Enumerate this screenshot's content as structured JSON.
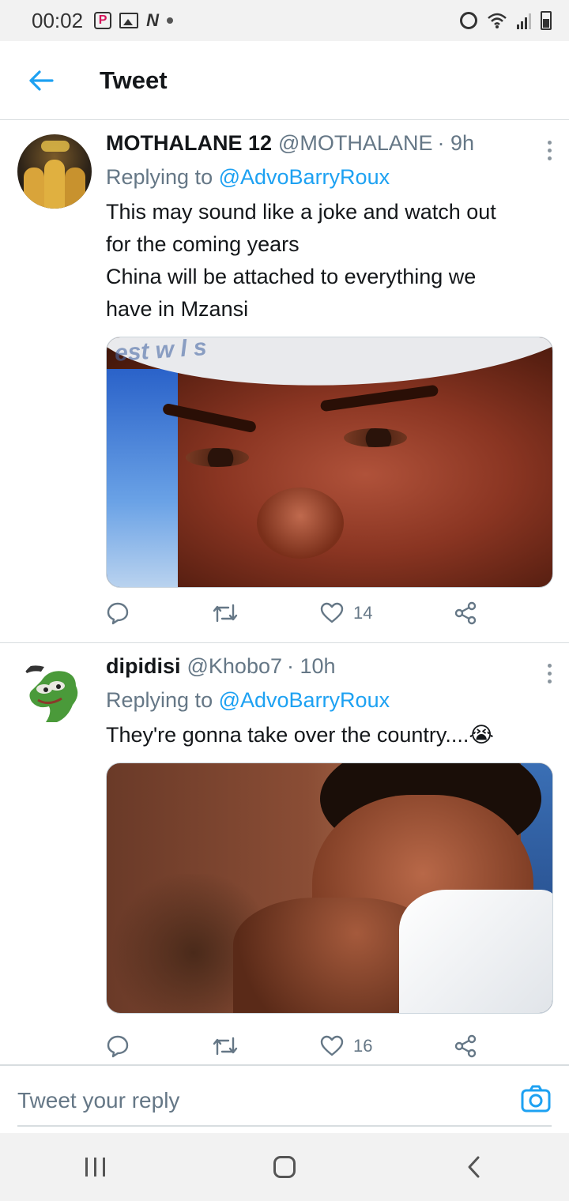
{
  "status_bar": {
    "time": "00:02",
    "icons": [
      "p-app-icon",
      "gallery-icon",
      "n-app-icon",
      "dot-icon",
      "alarm-icon",
      "wifi-icon",
      "signal-icon",
      "battery-icon"
    ]
  },
  "app_bar": {
    "title": "Tweet",
    "back_icon": "arrow-left-icon",
    "accent_color": "#1da1f2"
  },
  "tweets": [
    {
      "display_name": "MOTHALANE 12",
      "handle": "@MOTHALANE",
      "time": "· 9h",
      "replying_prefix": "Replying to ",
      "replying_to": "@AdvoBarryRoux",
      "text_lines": [
        "This may sound like a joke and watch out",
        "for the coming years",
        "China will be attached to everything we",
        "have in Mzansi"
      ],
      "media": "photo",
      "likes": "14"
    },
    {
      "display_name": "dipidisi",
      "handle": "@Khobo7",
      "time": "· 10h",
      "replying_prefix": "Replying to ",
      "replying_to": "@AdvoBarryRoux",
      "text": "They're gonna take over the country....",
      "emoji": "😭",
      "media": "photo",
      "likes": "16"
    }
  ],
  "composer": {
    "placeholder": "Tweet your reply",
    "camera_icon": "camera-icon"
  },
  "nav_bar": {
    "icons": [
      "recents-icon",
      "home-icon",
      "back-icon"
    ]
  }
}
